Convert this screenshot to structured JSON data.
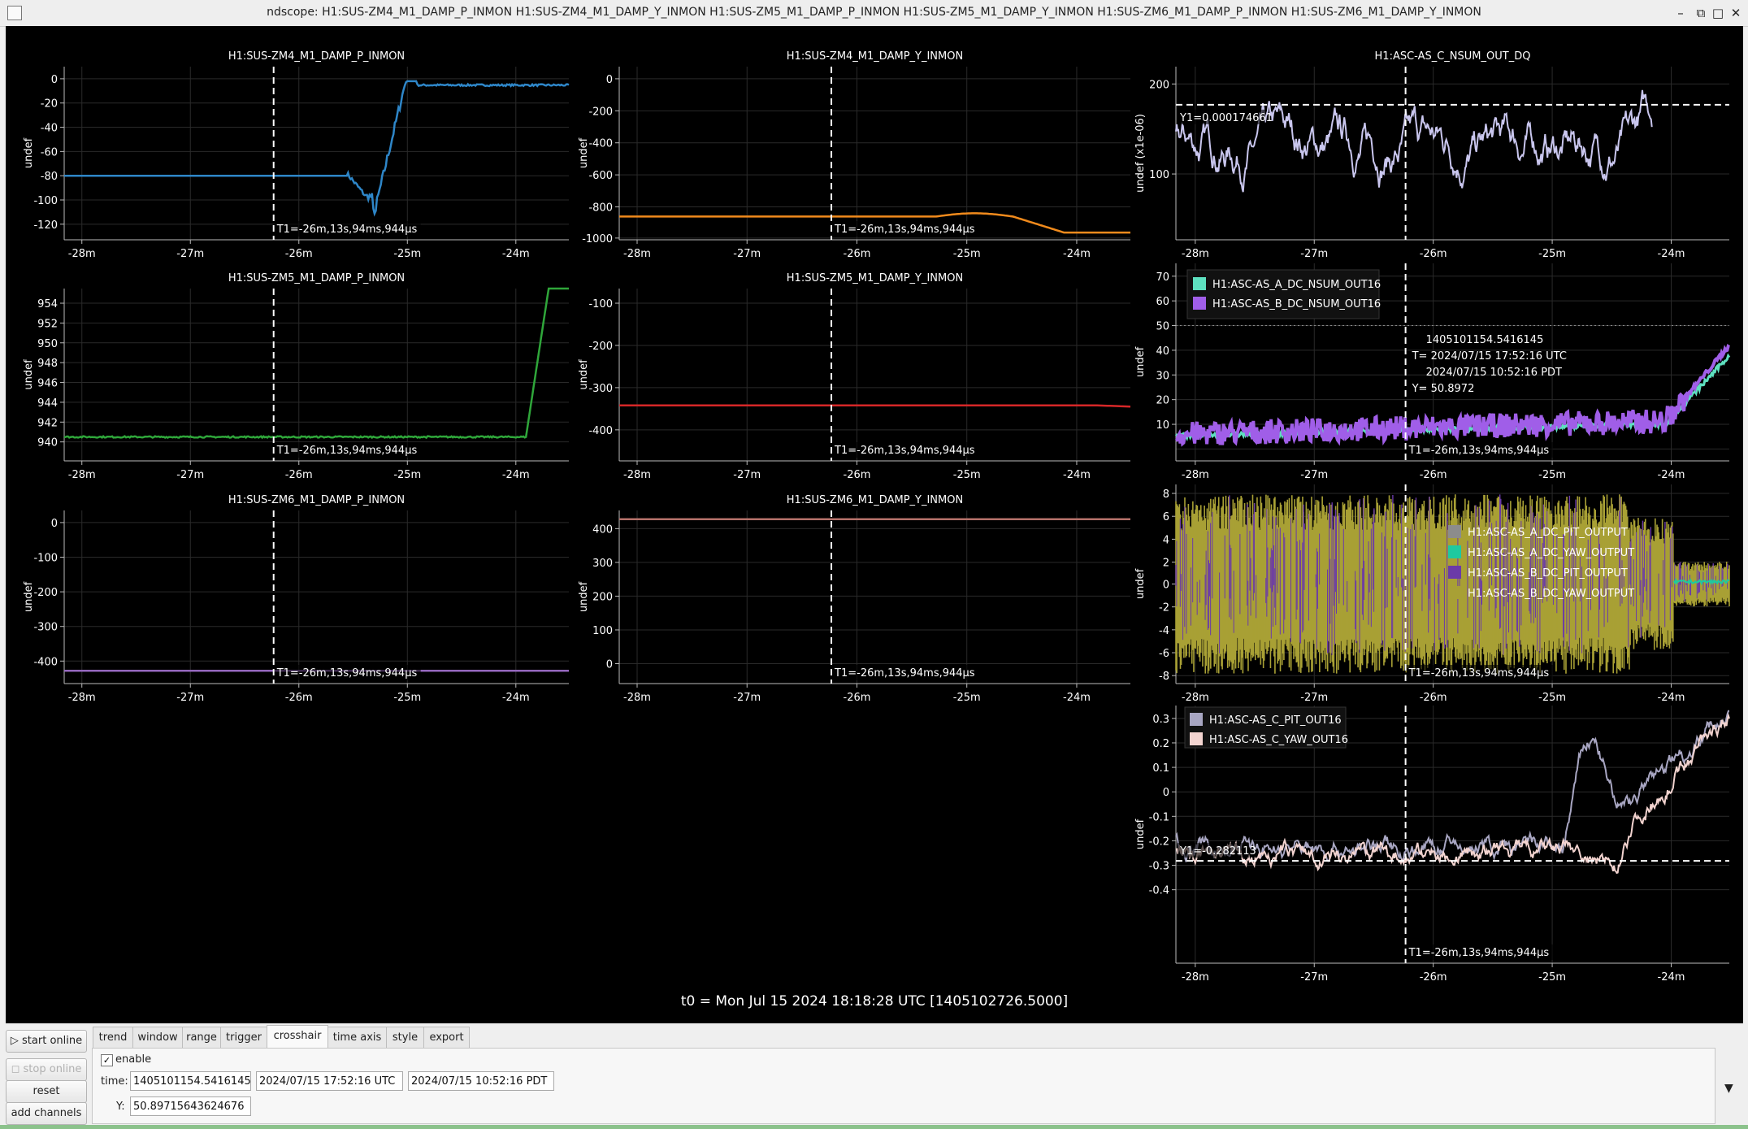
{
  "window": {
    "title": "ndscope: H1:SUS-ZM4_M1_DAMP_P_INMON H1:SUS-ZM4_M1_DAMP_Y_INMON H1:SUS-ZM5_M1_DAMP_P_INMON H1:SUS-ZM5_M1_DAMP_Y_INMON H1:SUS-ZM6_M1_DAMP_P_INMON H1:SUS-ZM6_M1_DAMP_Y_INMON",
    "min": "–",
    "restore": "⧉",
    "max": "□",
    "close": "✕"
  },
  "x_ticks": [
    "-28m",
    "-27m",
    "-26m",
    "-25m",
    "-24m"
  ],
  "cursor_label": "T1=-26m,13s,94ms,944µs",
  "t0": "t0 = Mon Jul 15 2024 18:18:28 UTC [1405102726.5000]",
  "plots": {
    "p1": {
      "title": "H1:SUS-ZM4_M1_DAMP_P_INMON",
      "ylabel": "undef",
      "yticks": [
        "0",
        "-20",
        "-40",
        "-60",
        "-80",
        "-100",
        "-120"
      ],
      "color": "#2e86c8"
    },
    "p2": {
      "title": "H1:SUS-ZM4_M1_DAMP_Y_INMON",
      "ylabel": "undef",
      "yticks": [
        "0",
        "-200",
        "-400",
        "-600",
        "-800",
        "-1000"
      ],
      "color": "#f08a1c"
    },
    "p3": {
      "title": "H1:ASC-AS_C_NSUM_OUT_DQ",
      "ylabel": "undef (x1e-06)",
      "yticks": [
        "200",
        "100"
      ],
      "color": "#c9c6ee",
      "hline_label": "Y1=0.000174661"
    },
    "p4": {
      "title": "H1:SUS-ZM5_M1_DAMP_P_INMON",
      "ylabel": "undef",
      "yticks": [
        "954",
        "952",
        "950",
        "948",
        "946",
        "944",
        "942",
        "940"
      ],
      "color": "#2fa63a"
    },
    "p5": {
      "title": "H1:SUS-ZM5_M1_DAMP_Y_INMON",
      "ylabel": "undef",
      "yticks": [
        "-100",
        "-200",
        "-300",
        "-400"
      ],
      "color": "#d62728"
    },
    "p6": {
      "ylabel": "undef",
      "yticks": [
        "70",
        "60",
        "50",
        "40",
        "30",
        "20",
        "10"
      ],
      "legend": [
        {
          "name": "H1:ASC-AS_A_DC_NSUM_OUT16",
          "color": "#5ee0c0"
        },
        {
          "name": "H1:ASC-AS_B_DC_NSUM_OUT16",
          "color": "#a05ee8"
        }
      ],
      "info": [
        "1405101154.5416145",
        "T= 2024/07/15 17:52:16 UTC",
        "2024/07/15 10:52:16 PDT",
        "Y= 50.8972"
      ]
    },
    "p7": {
      "title": "H1:SUS-ZM6_M1_DAMP_P_INMON",
      "ylabel": "undef",
      "yticks": [
        "0",
        "-100",
        "-200",
        "-300",
        "-400"
      ],
      "color": "#9467bd"
    },
    "p8": {
      "title": "H1:SUS-ZM6_M1_DAMP_Y_INMON",
      "ylabel": "undef",
      "yticks": [
        "400",
        "300",
        "200",
        "100",
        "0"
      ],
      "color": "#b5716a"
    },
    "p9": {
      "ylabel": "undef",
      "yticks": [
        "8",
        "6",
        "4",
        "2",
        "0",
        "-2",
        "-4",
        "-6",
        "-8"
      ],
      "legend": [
        {
          "name": "H1:ASC-AS_A_DC_PIT_OUTPUT",
          "color": "#8c8c8c"
        },
        {
          "name": "H1:ASC-AS_A_DC_YAW_OUTPUT",
          "color": "#1ec9a0"
        },
        {
          "name": "H1:ASC-AS_B_DC_PIT_OUTPUT",
          "color": "#6b3aa8"
        },
        {
          "name": "H1:ASC-AS_B_DC_YAW_OUTPUT",
          "color": "#a8a035"
        }
      ]
    },
    "p10": {
      "ylabel": "undef",
      "yticks": [
        "0.3",
        "0.2",
        "0.1",
        "0",
        "-0.1",
        "-0.2",
        "-0.3",
        "-0.4"
      ],
      "legend": [
        {
          "name": "H1:ASC-AS_C_PIT_OUT16",
          "color": "#a8a6c2"
        },
        {
          "name": "H1:ASC-AS_C_YAW_OUT16",
          "color": "#f3d4d0"
        }
      ],
      "hline_label": "Y1=-0.282113"
    }
  },
  "controls": {
    "start_online": "start online",
    "stop_online": "stop online",
    "reset": "reset",
    "add_channels": "add channels",
    "tabs": [
      "trend",
      "window",
      "range",
      "trigger",
      "crosshair",
      "time axis",
      "style",
      "export"
    ],
    "active_tab": "crosshair",
    "enable_label": "enable",
    "enable_checked": true,
    "time_label": "time:",
    "time_gps": "1405101154.5416145",
    "time_utc": "2024/07/15 17:52:16 UTC",
    "time_pdt": "2024/07/15 10:52:16 PDT",
    "y_label": "Y:",
    "y_value": "50.89715643624676",
    "expand_icon": "▼"
  }
}
